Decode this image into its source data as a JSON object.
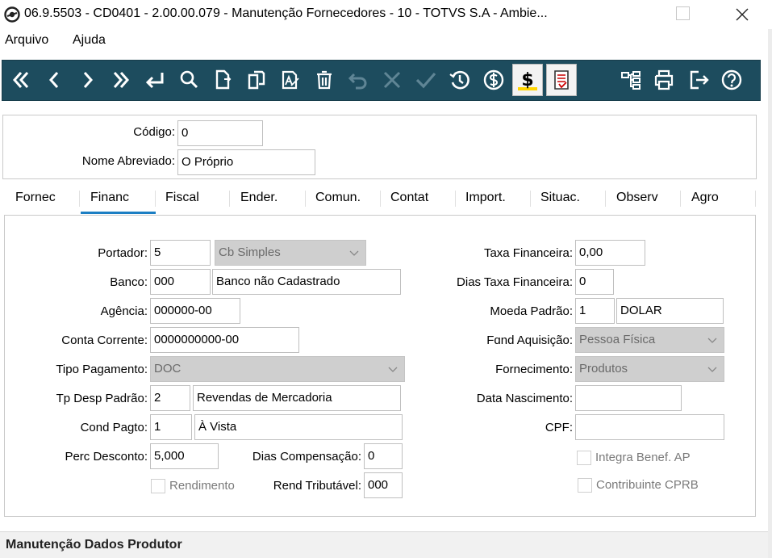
{
  "window": {
    "title": "06.9.5503 - CD0401 - 2.00.00.079 - Manutenção Fornecedores - 10 - TOTVS S.A - Ambie..."
  },
  "menu": {
    "items": [
      "Arquivo",
      "Ajuda"
    ]
  },
  "toolbar": {
    "icons": [
      "first-icon",
      "prev-icon",
      "next-icon",
      "last-icon",
      "goto-icon",
      "search-icon",
      "new-icon",
      "copy-icon",
      "edit-icon",
      "delete-icon",
      "undo-icon",
      "cancel-icon",
      "save-icon",
      "history-icon",
      "currency-icon",
      "financial-icon",
      "report-icon",
      "tree-icon",
      "print-icon",
      "exit-icon",
      "help-icon"
    ],
    "financial_glyph": "$"
  },
  "header": {
    "codigo_label": "Código:",
    "codigo_value": "0",
    "nome_label": "Nome Abreviado:",
    "nome_value": "O Próprio"
  },
  "tabs": [
    "Fornec",
    "Financ",
    "Fiscal",
    "Ender.",
    "Comun.",
    "Contat",
    "Import.",
    "Situac.",
    "Observ",
    "Agro"
  ],
  "form": {
    "portador": {
      "label": "Portador:",
      "value": "5",
      "combo": "Cb Simples"
    },
    "banco": {
      "label": "Banco:",
      "code": "000",
      "name": "Banco não Cadastrado"
    },
    "agencia": {
      "label": "Agência:",
      "value": "000000-00"
    },
    "conta": {
      "label": "Conta Corrente:",
      "value": "0000000000-00"
    },
    "tipo_pagamento": {
      "label": "Tipo Pagamento:",
      "value": "DOC"
    },
    "tp_desp": {
      "label": "Tp Desp Padrão:",
      "code": "2",
      "name": "Revendas de Mercadoria"
    },
    "cond_pagto": {
      "label": "Cond Pagto:",
      "code": "1",
      "name": "À Vista"
    },
    "perc_desconto": {
      "label": "Perc Desconto:",
      "value": "5,000"
    },
    "dias_compensacao": {
      "label": "Dias Compensação:",
      "value": "0"
    },
    "rendimento": {
      "label": "Rendimento"
    },
    "rend_tributavel": {
      "label": "Rend Tributável:",
      "value": "000"
    },
    "taxa_financeira": {
      "label": "Taxa Financeira:",
      "value": "0,00"
    },
    "dias_taxa": {
      "label": "Dias Taxa Financeira:",
      "value": "0"
    },
    "moeda": {
      "label": "Moeda Padrão:",
      "code": "1",
      "name": "DOLAR"
    },
    "fund_aquisicao": {
      "label": "Fɑnd Aquisição:",
      "value": "Pessoa Física"
    },
    "fornecimento": {
      "label": "Fornecimento:",
      "value": "Produtos"
    },
    "data_nascimento": {
      "label": "Data Nascimento:",
      "value": ""
    },
    "cpf": {
      "label": "CPF:",
      "value": ""
    },
    "integra_benef": {
      "label": "Integra Benef. AP"
    },
    "contribuinte_cprb": {
      "label": "Contribuinte CPRB"
    }
  },
  "status": {
    "text": "Manutenção Dados Produtor"
  },
  "colors": {
    "toolbar_bg": "#1d4c5e",
    "tab_accent": "#1b7ec3",
    "disabled_field": "#cfcfcf"
  }
}
